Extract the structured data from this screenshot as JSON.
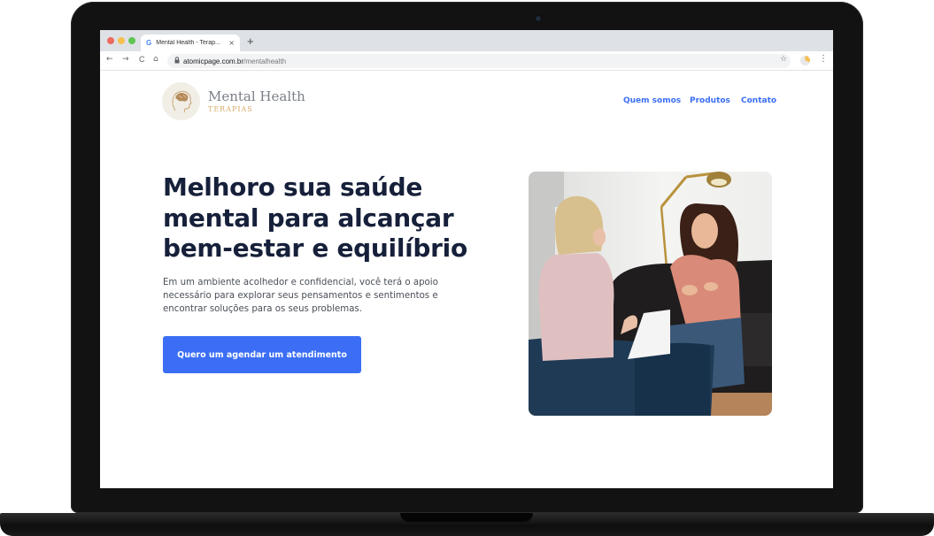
{
  "browser": {
    "tab_favicon": "G",
    "tab_title": "Mental Health - Terap...",
    "tab_close": "×",
    "new_tab": "+",
    "url_host": "atomicpage.com.br",
    "url_path": "/mentalhealth",
    "back": "←",
    "forward": "→",
    "reload": "C",
    "home": "⌂",
    "star": "☆",
    "menu": "⋮"
  },
  "logo": {
    "title": "Mental Health",
    "subtitle": "TERAPIAS"
  },
  "nav": {
    "items": [
      "Quem somos",
      "Produtos",
      "Contato"
    ]
  },
  "hero": {
    "title_line1": "Melhoro sua saúde",
    "title_line2": "mental para alcançar",
    "title_line3": "bem-estar e equilíbrio",
    "text": "Em um ambiente acolhedor e confidencial, você terá o apoio necessário para explorar seus pensamentos e sentimentos e encontrar soluções para os seus problemas.",
    "cta_label": "Quero um agendar um atendimento"
  },
  "colors": {
    "accent": "#3b6ef5",
    "heading": "#16203a",
    "logo_gold": "#d4aa6a",
    "laptop": "#121212"
  }
}
